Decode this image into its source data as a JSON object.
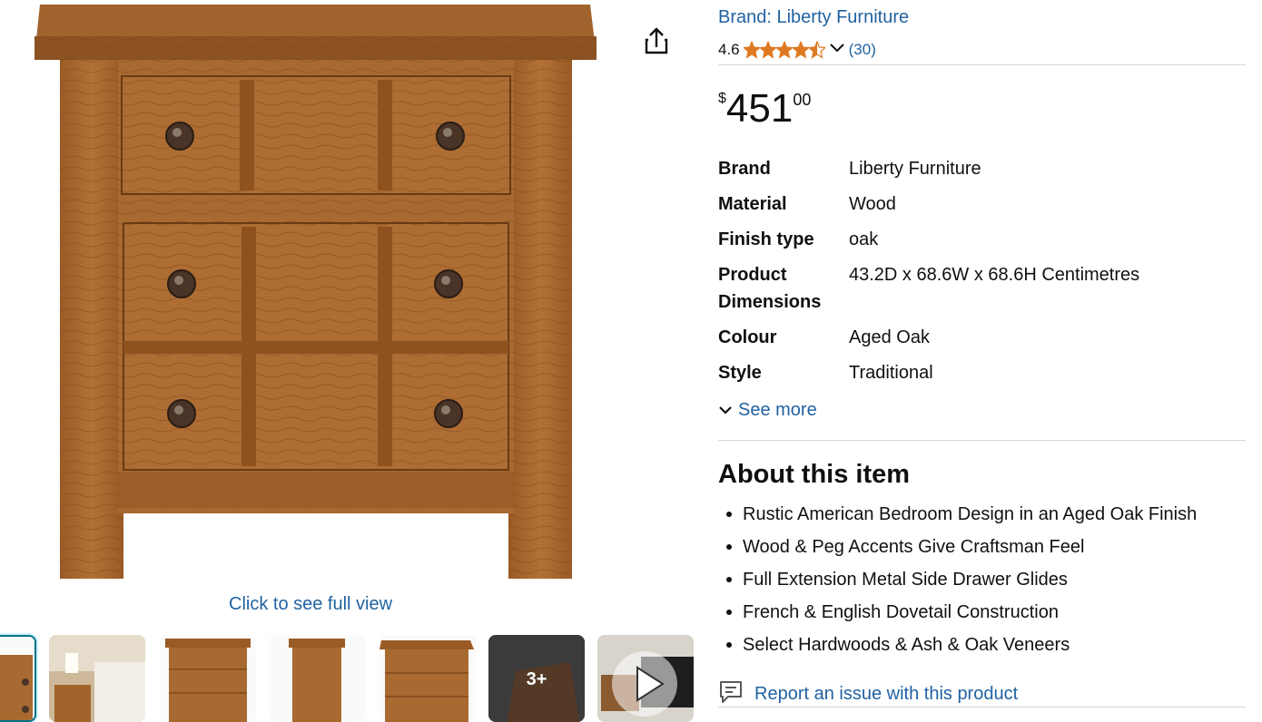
{
  "gallery": {
    "full_view_label": "Click to see full view",
    "more_images_label": "3+"
  },
  "product": {
    "brand_link": "Brand: Liberty Furniture",
    "rating_value": "4.6",
    "rating_stars": 4.6,
    "rating_count": "(30)",
    "price": {
      "symbol": "$",
      "whole": "451",
      "fraction": "00"
    }
  },
  "specs": [
    {
      "key": "Brand",
      "value": "Liberty Furniture"
    },
    {
      "key": "Material",
      "value": "Wood"
    },
    {
      "key": "Finish type",
      "value": "oak"
    },
    {
      "key": "Product Dimensions",
      "value": "43.2D x 68.6W x 68.6H Centimetres"
    },
    {
      "key": "Colour",
      "value": "Aged Oak"
    },
    {
      "key": "Style",
      "value": "Traditional"
    }
  ],
  "see_more_label": "See more",
  "about": {
    "title": "About this item",
    "bullets": [
      "Rustic American Bedroom Design in an Aged Oak Finish",
      "Wood & Peg Accents Give Craftsman Feel",
      "Full Extension Metal Side Drawer Glides",
      "French & English Dovetail Construction",
      "Select Hardwoods & Ash & Oak Veneers"
    ]
  },
  "report_label": "Report an issue with this product",
  "colors": {
    "link": "#2162a1",
    "star": "#de7921",
    "selected_border": "#007185",
    "wood": "#a9672c"
  }
}
